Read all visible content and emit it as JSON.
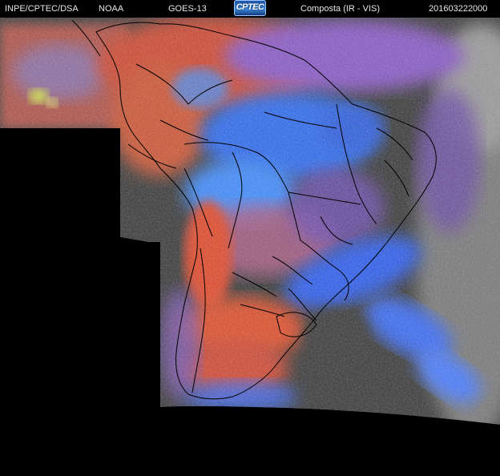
{
  "header": {
    "institution": "INPE/CPTEC/DSA",
    "agency": "NOAA",
    "satellite": "GOES-13",
    "logo_text": "CPTEC",
    "product": "Composta (IR - VIS)",
    "timestamp": "201603222000"
  },
  "colors": {
    "background": "#000000",
    "cloud_gray": "#3a3a3a",
    "cloud_light": "#8a8a8a",
    "warm_red": "#d9482a",
    "salmon": "#c96a5a",
    "violet": "#8a5ac8",
    "cold_blue": "#2f6cf0",
    "bright_blue": "#3f8cff",
    "yellow_green": "#d6e84a",
    "border": "#000000"
  },
  "layers": {
    "image_coverage": "satellite-composite",
    "political_borders": "country-and-state-outlines"
  }
}
